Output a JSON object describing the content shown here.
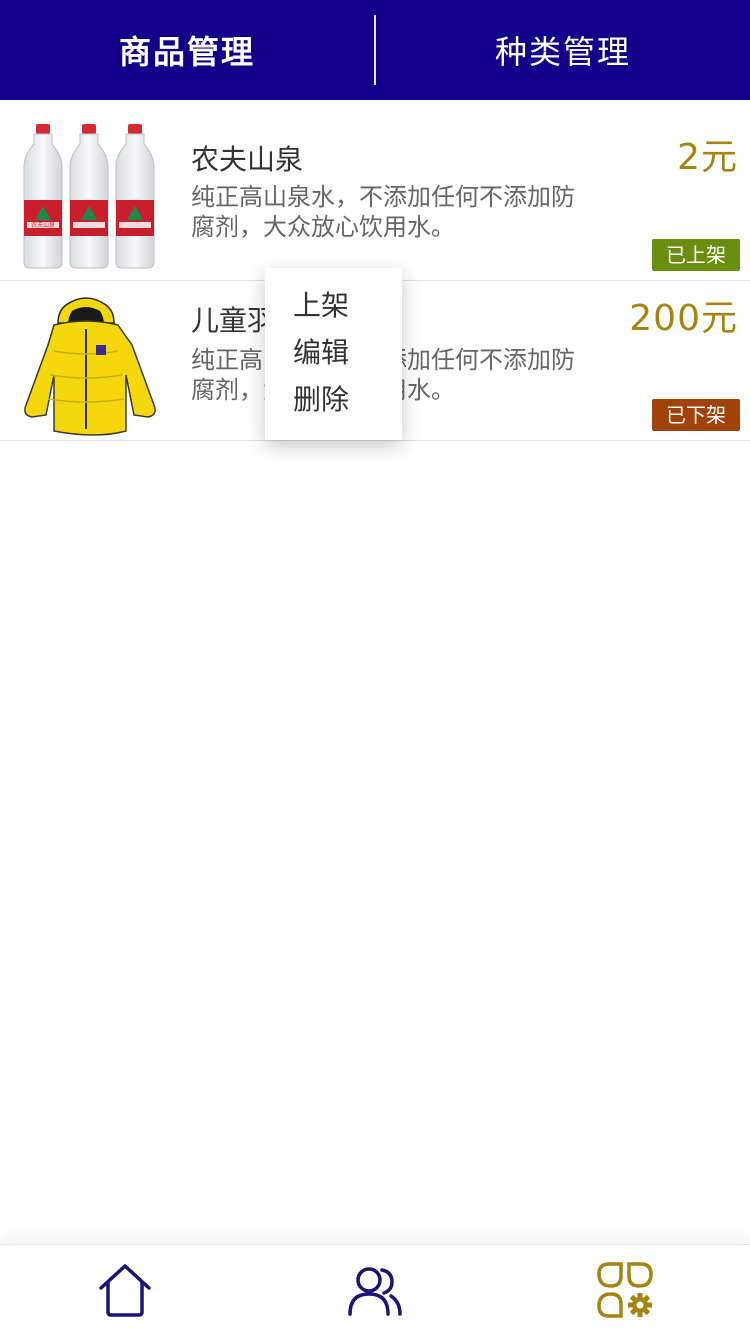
{
  "header": {
    "tabs": [
      {
        "label": "商品管理",
        "active": true
      },
      {
        "label": "种类管理",
        "active": false
      }
    ]
  },
  "products": [
    {
      "name": "农夫山泉",
      "description": "纯正高山泉水，不添加任何不添加防腐剂，大众放心饮用水。",
      "price": "2元",
      "status": "已上架",
      "status_color": "#6b8e10",
      "image_label": "农夫山泉"
    },
    {
      "name": "儿童羽",
      "description": "纯正高山泉水，不添加任何不添加防腐剂，大众放心饮用水。",
      "price": "200元",
      "status": "已下架",
      "status_color": "#a2420b"
    }
  ],
  "context_menu": {
    "items": [
      "上架",
      "编辑",
      "删除"
    ]
  },
  "bottom_nav": {
    "items": [
      {
        "icon": "home-icon",
        "color": "#1a1378"
      },
      {
        "icon": "users-icon",
        "color": "#1a1378"
      },
      {
        "icon": "apps-settings-icon",
        "color": "#a58512"
      }
    ]
  },
  "colors": {
    "header_bg": "#12008a",
    "price": "#a58512"
  }
}
